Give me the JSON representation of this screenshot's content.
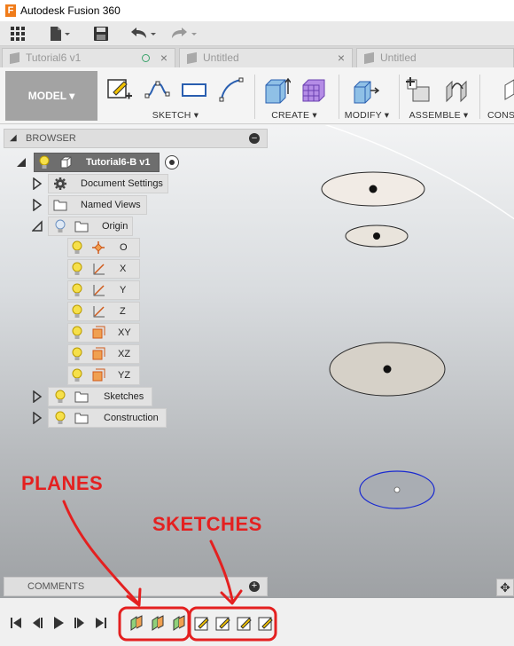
{
  "window": {
    "title": "Autodesk Fusion 360",
    "app_icon_glyph": "F"
  },
  "quick_access": [
    {
      "name": "grid-menu-icon"
    },
    {
      "name": "file-icon"
    },
    {
      "name": "save-icon"
    },
    {
      "name": "undo-icon"
    },
    {
      "name": "redo-icon"
    }
  ],
  "tabs": [
    {
      "label": "Tutorial6 v1"
    },
    {
      "label": "Untitled"
    },
    {
      "label": "Untitled"
    }
  ],
  "toolbar": {
    "workspace": "MODEL ▾",
    "groups": {
      "sketch": "SKETCH ▾",
      "create": "CREATE ▾",
      "modify": "MODIFY ▾",
      "assemble": "ASSEMBLE ▾",
      "construct": "CONS"
    }
  },
  "browser": {
    "header": "BROWSER",
    "root": "Tutorial6-B v1",
    "items": {
      "document_settings": "Document Settings",
      "named_views": "Named Views",
      "origin": "Origin",
      "o": "O",
      "x": "X",
      "y": "Y",
      "z": "Z",
      "xy": "XY",
      "xz": "XZ",
      "yz": "YZ",
      "sketches": "Sketches",
      "construction": "Construction"
    }
  },
  "comments": {
    "header": "COMMENTS"
  },
  "annotations": {
    "planes": "PLANES",
    "sketches": "SKETCHES"
  },
  "colors": {
    "accent_orange": "#f07c1a",
    "annotation_red": "#e42020",
    "selection_blue": "#1a2ad0"
  }
}
